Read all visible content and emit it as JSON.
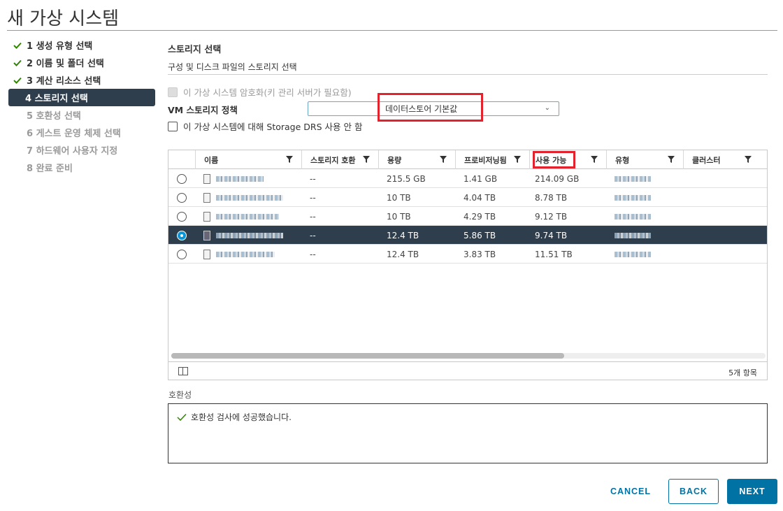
{
  "window": {
    "title": "새 가상 시스템"
  },
  "steps": [
    {
      "label": "1 생성 유형 선택",
      "state": "done"
    },
    {
      "label": "2 이름 및 폴더 선택",
      "state": "done"
    },
    {
      "label": "3 계산 리소스 선택",
      "state": "done"
    },
    {
      "label": "4 스토리지 선택",
      "state": "active"
    },
    {
      "label": "5 호환성 선택",
      "state": "disabled"
    },
    {
      "label": "6 게스트 운영 체제 선택",
      "state": "disabled"
    },
    {
      "label": "7 하드웨어 사용자 지정",
      "state": "disabled"
    },
    {
      "label": "8 완료 준비",
      "state": "disabled"
    }
  ],
  "section": {
    "title": "스토리지 선택",
    "subtitle": "구성 및 디스크 파일의 스토리지 선택"
  },
  "options": {
    "encrypt_label": "이 가상 시스템 암호화(키 관리 서버가 필요함)",
    "policy_label": "VM 스토리지 정책",
    "policy_value": "데이터스토어 기본값",
    "drs_label": "이 가상 시스템에 대해 Storage DRS 사용 안 함"
  },
  "grid": {
    "columns": [
      "이름",
      "스토리지 호환",
      "용량",
      "프로비저닝됨",
      "사용 가능",
      "유형",
      "클러스터"
    ],
    "rows": [
      {
        "compat": "--",
        "capacity": "215.5 GB",
        "provisioned": "1.41 GB",
        "free": "214.09 GB",
        "selected": false
      },
      {
        "compat": "--",
        "capacity": "10 TB",
        "provisioned": "4.04 TB",
        "free": "8.78 TB",
        "selected": false
      },
      {
        "compat": "--",
        "capacity": "10 TB",
        "provisioned": "4.29 TB",
        "free": "9.12 TB",
        "selected": false
      },
      {
        "compat": "--",
        "capacity": "12.4 TB",
        "provisioned": "5.86 TB",
        "free": "9.74 TB",
        "selected": true
      },
      {
        "compat": "--",
        "capacity": "12.4 TB",
        "provisioned": "3.83 TB",
        "free": "11.51 TB",
        "selected": false
      }
    ],
    "item_count": "5개 항목"
  },
  "compatibility": {
    "label": "호환성",
    "message": "호환성 검사에 성공했습니다."
  },
  "buttons": {
    "cancel": "CANCEL",
    "back": "BACK",
    "next": "NEXT"
  },
  "colors": {
    "accent": "#0072a3",
    "highlight": "#e2222c",
    "selected_row": "#2e3e4d",
    "success": "#2f8400"
  }
}
